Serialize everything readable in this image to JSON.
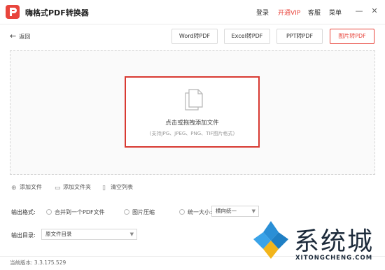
{
  "app": {
    "title": "嗨格式PDF转换器"
  },
  "topbar": {
    "login": "登录",
    "vip": "开通VIP",
    "service": "客服",
    "menu": "菜单"
  },
  "nav": {
    "back": "返回"
  },
  "modes": [
    "Word转PDF",
    "Excel转PDF",
    "PPT转PDF",
    "图片转PDF"
  ],
  "dropzone": {
    "main": "点击或拖拽添加文件",
    "sub": "(支持JPG、JPEG、PNG、TIF图片格式)"
  },
  "actions": {
    "add_file": "添加文件",
    "add_folder": "添加文件夹",
    "clear_list": "清空列表"
  },
  "output_format": {
    "label": "输出格式:",
    "options": [
      "合并到一个PDF文件",
      "图片压缩",
      "统一大小:"
    ],
    "orientation": "横向统一"
  },
  "output_dir": {
    "label": "输出目录:",
    "value": "原文件目录"
  },
  "footer": {
    "version": "当前版本: 3.3.175.529"
  },
  "watermark": {
    "cn": "系统城",
    "en": "XITONGCHENG.COM"
  },
  "colors": {
    "accent": "#e8453c"
  }
}
